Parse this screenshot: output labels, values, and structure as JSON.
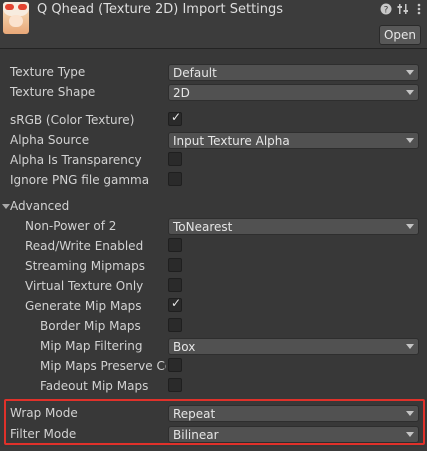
{
  "header": {
    "title": "Q Qhead (Texture 2D) Import Settings",
    "open_label": "Open",
    "icons": [
      "help-icon",
      "preset-icon",
      "more-icon"
    ]
  },
  "rows": {
    "texture_type": {
      "label": "Texture Type",
      "value": "Default"
    },
    "texture_shape": {
      "label": "Texture Shape",
      "value": "2D"
    },
    "srgb": {
      "label": "sRGB (Color Texture)",
      "checked": true
    },
    "alpha_source": {
      "label": "Alpha Source",
      "value": "Input Texture Alpha"
    },
    "alpha_transparency": {
      "label": "Alpha Is Transparency",
      "checked": false
    },
    "ignore_png_gamma": {
      "label": "Ignore PNG file gamma",
      "checked": false
    },
    "advanced": {
      "label": "Advanced"
    },
    "non_power_of_2": {
      "label": "Non-Power of 2",
      "value": "ToNearest"
    },
    "read_write": {
      "label": "Read/Write Enabled",
      "checked": false
    },
    "streaming_mipmaps": {
      "label": "Streaming Mipmaps",
      "checked": false
    },
    "virtual_texture": {
      "label": "Virtual Texture Only",
      "checked": false
    },
    "generate_mipmaps": {
      "label": "Generate Mip Maps",
      "checked": true
    },
    "border_mipmaps": {
      "label": "Border Mip Maps",
      "checked": false
    },
    "mipmap_filtering": {
      "label": "Mip Map Filtering",
      "value": "Box"
    },
    "mipmaps_preserve": {
      "label": "Mip Maps Preserve Co",
      "checked": false
    },
    "fadeout_mipmaps": {
      "label": "Fadeout Mip Maps",
      "checked": false
    },
    "wrap_mode": {
      "label": "Wrap Mode",
      "value": "Repeat"
    },
    "filter_mode": {
      "label": "Filter Mode",
      "value": "Bilinear"
    }
  },
  "check_glyph": "✓",
  "colors": {
    "highlight": "#e0312a",
    "background": "#383838"
  }
}
